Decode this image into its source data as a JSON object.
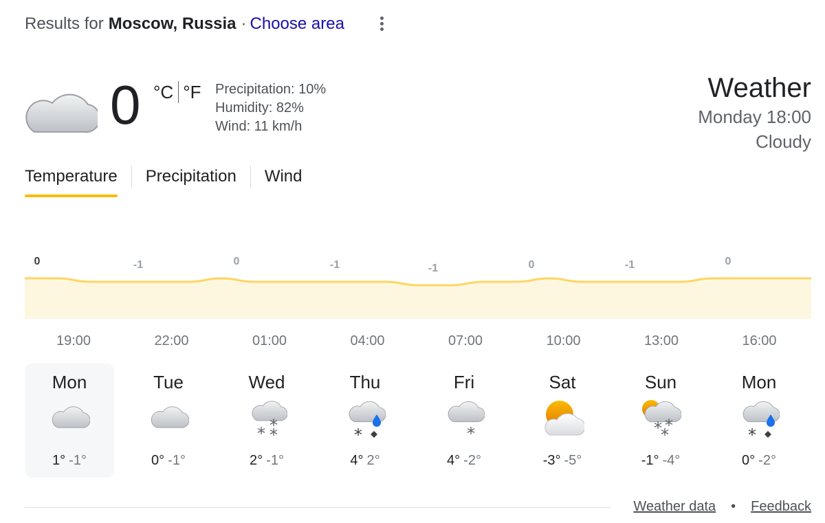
{
  "header": {
    "results_prefix": "Results for",
    "location": "Moscow, Russia",
    "separator": "·",
    "choose_area": "Choose area",
    "menu_icon": "more-vert-icon"
  },
  "current": {
    "icon": "cloudy-icon",
    "temperature": "0",
    "unit_c": "°C",
    "unit_f": "°F",
    "precipitation": "Precipitation: 10%",
    "humidity": "Humidity: 82%",
    "wind": "Wind: 11 km/h"
  },
  "summary": {
    "title": "Weather",
    "datetime": "Monday 18:00",
    "condition": "Cloudy"
  },
  "tabs": [
    {
      "label": "Temperature",
      "active": true
    },
    {
      "label": "Precipitation",
      "active": false
    },
    {
      "label": "Wind",
      "active": false
    }
  ],
  "chart_data": {
    "type": "area",
    "x": [
      "18:00",
      "19:00",
      "20:00",
      "21:00",
      "22:00",
      "23:00",
      "00:00",
      "01:00",
      "02:00",
      "03:00",
      "04:00",
      "05:00",
      "06:00",
      "07:00",
      "08:00",
      "09:00",
      "10:00",
      "11:00",
      "12:00",
      "13:00",
      "14:00",
      "15:00",
      "16:00",
      "17:00",
      "18:00"
    ],
    "values": [
      0,
      0,
      -1,
      -1,
      -1,
      -1,
      0,
      -1,
      -1,
      -1,
      -1,
      -1,
      -2,
      -2,
      -1,
      -1,
      0,
      -1,
      -1,
      -1,
      -1,
      0,
      0,
      0,
      0
    ],
    "data_labels": [
      {
        "x": "18:00",
        "text": "0"
      },
      {
        "x": "21:00",
        "text": "-1"
      },
      {
        "x": "00:00",
        "text": "0"
      },
      {
        "x": "03:00",
        "text": "-1"
      },
      {
        "x": "06:00",
        "text": "-1"
      },
      {
        "x": "09:00",
        "text": "0"
      },
      {
        "x": "12:00",
        "text": "-1"
      },
      {
        "x": "15:00",
        "text": "0"
      }
    ],
    "tick_labels": [
      "19:00",
      "22:00",
      "01:00",
      "04:00",
      "07:00",
      "10:00",
      "13:00",
      "16:00"
    ],
    "colors": {
      "line": "#fdd663",
      "fill": "#fef7e0"
    }
  },
  "forecast": [
    {
      "day": "Mon",
      "icon": "cloudy-icon",
      "high": "1°",
      "low": "-1°",
      "selected": true
    },
    {
      "day": "Tue",
      "icon": "cloudy-icon",
      "high": "0°",
      "low": "-1°",
      "selected": false
    },
    {
      "day": "Wed",
      "icon": "snow-icon",
      "high": "2°",
      "low": "-1°",
      "selected": false
    },
    {
      "day": "Thu",
      "icon": "rain-and-snow-icon",
      "high": "4°",
      "low": "2°",
      "selected": false
    },
    {
      "day": "Fri",
      "icon": "light-snow-icon",
      "high": "4°",
      "low": "-2°",
      "selected": false
    },
    {
      "day": "Sat",
      "icon": "partly-cloudy-icon",
      "high": "-3°",
      "low": "-5°",
      "selected": false
    },
    {
      "day": "Sun",
      "icon": "snow-showers-icon",
      "high": "-1°",
      "low": "-4°",
      "selected": false
    },
    {
      "day": "Mon",
      "icon": "rain-and-snow-icon",
      "high": "0°",
      "low": "-2°",
      "selected": false
    }
  ],
  "footer": {
    "weather_data": "Weather data",
    "dot": "•",
    "feedback": "Feedback"
  }
}
